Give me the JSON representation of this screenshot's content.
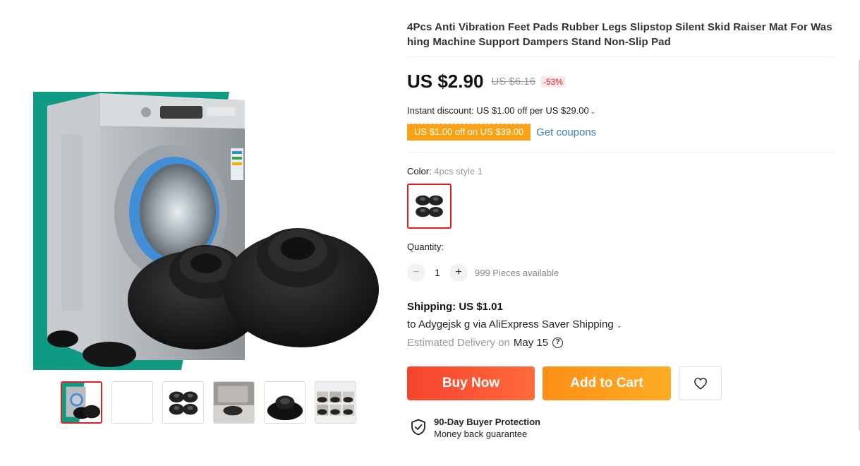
{
  "product": {
    "title": "4Pcs Anti Vibration Feet Pads Rubber Legs Slipstop Silent Skid Raiser Mat For Washing Machine Support Dampers Stand Non-Slip Pad"
  },
  "gallery": {
    "main_image_icon": "washing-machine-with-rubber-feet-pads",
    "thumbnails": [
      {
        "icon": "washing-machine-thumb",
        "selected": true
      },
      {
        "icon": "blank-thumb",
        "selected": false
      },
      {
        "icon": "four-pads-thumb",
        "selected": false
      },
      {
        "icon": "machine-foot-closeup-thumb",
        "selected": false
      },
      {
        "icon": "single-pad-thumb",
        "selected": false
      },
      {
        "icon": "pad-collage-thumb",
        "selected": false
      }
    ]
  },
  "pricing": {
    "current": "US $2.90",
    "original": "US $6.16",
    "discount": "-53%",
    "instant_discount": "Instant discount: US $1.00 off per US $29.00",
    "coupon": "US $1.00 off on US $39.00",
    "get_coupons": "Get coupons"
  },
  "variant": {
    "label": "Color:",
    "selected": "4pcs style 1",
    "swatch_icon": "four-black-pads"
  },
  "quantity": {
    "label": "Quantity:",
    "minus": "−",
    "value": "1",
    "plus": "+",
    "available": "999 Pieces available"
  },
  "shipping": {
    "title": "Shipping: US $1.01",
    "to": "to Adygejsk g via AliExpress Saver Shipping",
    "estimated_label": "Estimated Delivery on",
    "estimated_date": "May 15",
    "help_icon": "question-circle-icon"
  },
  "actions": {
    "buy_now": "Buy Now",
    "add_to_cart": "Add to Cart",
    "wishlist_icon": "heart-icon"
  },
  "protection": {
    "icon": "shield-check-icon",
    "title": "90-Day Buyer Protection",
    "subtitle": "Money back guarantee"
  },
  "colors": {
    "accent_red": "#e02020",
    "buy_now": "#f6432e",
    "add_to_cart": "#fc8f17",
    "coupon": "#f8a214",
    "link": "#3a83b8",
    "image_bg": "#0f9a84"
  }
}
